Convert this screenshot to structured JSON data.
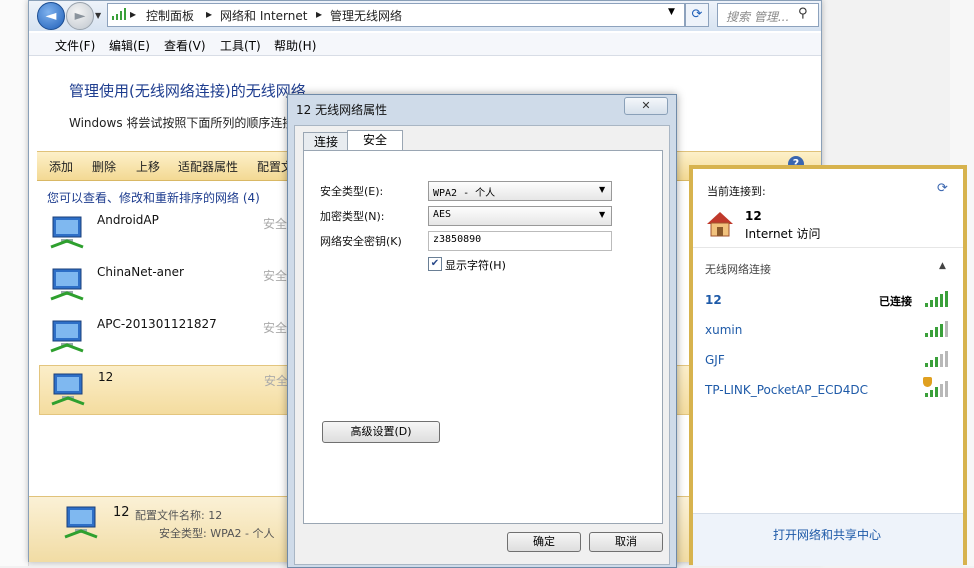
{
  "address_bar": {
    "back_arrow": "◄",
    "forward_arrow": "►",
    "breadcrumbs": [
      "控制面板",
      "网络和 Internet",
      "管理无线网络"
    ],
    "search_placeholder": "搜索 管理...",
    "refresh_icon": "refresh-icon",
    "search_icon": "search-icon"
  },
  "menu": [
    "文件(F)",
    "编辑(E)",
    "查看(V)",
    "工具(T)",
    "帮助(H)"
  ],
  "page": {
    "heading": "管理使用(无线网络连接)的无线网络",
    "subtext": "Windows 将尝试按照下面所列的顺序连接"
  },
  "toolbar": [
    "添加",
    "删除",
    "上移",
    "适配器属性",
    "配置文"
  ],
  "help_label": "?",
  "network_list": {
    "count_label": "您可以查看、修改和重新排序的网络 (4)",
    "networks": [
      {
        "name": "AndroidAP",
        "security": "安全"
      },
      {
        "name": "ChinaNet-aner",
        "security": "安全"
      },
      {
        "name": "APC-201301121827",
        "security": "安全"
      },
      {
        "name": "12",
        "security": "安全"
      }
    ]
  },
  "details": {
    "name": "12",
    "profile": "配置文件名称: 12",
    "security": "安全类型: WPA2 - 个人"
  },
  "dialog": {
    "title": "12 无线网络属性",
    "close_label": "✕",
    "tabs": [
      "连接",
      "安全"
    ],
    "active_tab": "安全",
    "security_type_label": "安全类型(E):",
    "security_type_value": "WPA2 - 个人",
    "encryption_type_label": "加密类型(N):",
    "encryption_type_value": "AES",
    "key_label": "网络安全密钥(K)",
    "key_value": "z3850890",
    "show_chars_checked": true,
    "show_chars_label": "显示字符(H)",
    "advanced_button": "高级设置(D)",
    "ok_button": "确定",
    "cancel_button": "取消"
  },
  "flyout": {
    "current_label": "当前连接到:",
    "current_network": "12",
    "current_access": "Internet 访问",
    "wireless_header": "无线网络连接",
    "networks": [
      {
        "name": "12",
        "status": "已连接",
        "signal": 5
      },
      {
        "name": "xumin",
        "status": "",
        "signal": 4
      },
      {
        "name": "GJF",
        "status": "",
        "signal": 3
      },
      {
        "name": "TP-LINK_PocketAP_ECD4DC",
        "status": "",
        "signal": 3,
        "unsecured": true
      }
    ],
    "footer_link": "打开网络和共享中心"
  },
  "colors": {
    "link_blue": "#1e5aa8",
    "selection": "#f4dc9f",
    "flyout_border": "#d7b34e",
    "signal_green": "#3aa03a"
  }
}
